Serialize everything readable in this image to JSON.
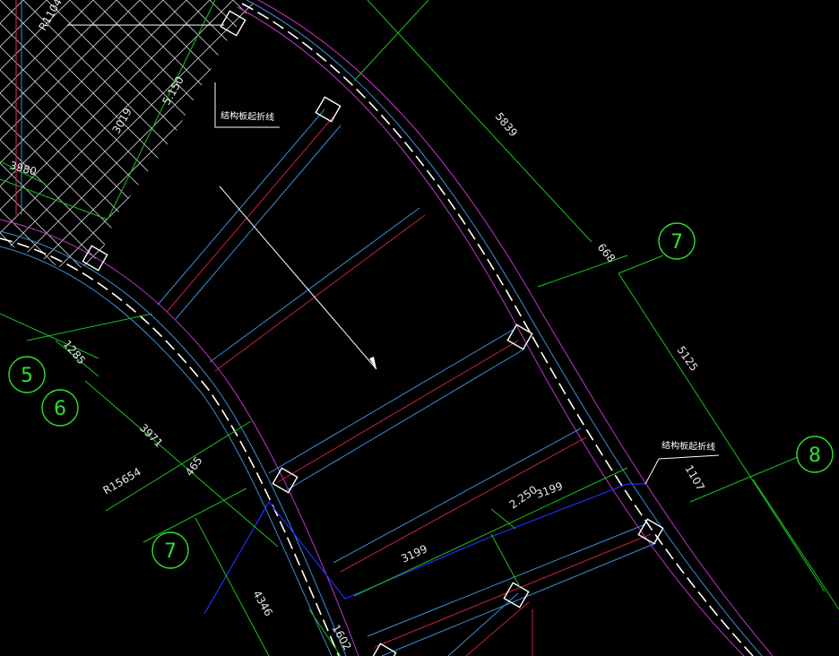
{
  "drawing": {
    "colors": {
      "background": "#000000",
      "axis_bubble": "#2fe02f",
      "dimension": "#19c419",
      "beam_edge": "#3a8fd6",
      "beam_center": "#c81e4b",
      "slab_edge": "#c035c8",
      "text": "#e8e8e8",
      "blue_line": "#1f2fff",
      "hatch": "#cfcfcf"
    },
    "grid_axes": [
      {
        "label": "5"
      },
      {
        "label": "6"
      },
      {
        "label": "7"
      },
      {
        "label": "7"
      },
      {
        "label": "8"
      }
    ],
    "dimensions": {
      "r1104": "R1104",
      "d5839": "5839",
      "d668": "668",
      "d5125": "5125",
      "d1107": "1107",
      "d3980": "3980",
      "d3019": "3019",
      "d5150": "5.150",
      "d1285": "1285",
      "d3971": "3971",
      "r15654": "R15654",
      "d465": "465",
      "d2250": "2.250",
      "d3199a": "3199",
      "d3199b": "3199",
      "d4346": "4346",
      "d1602": "1602"
    },
    "notes": {
      "fold_line_top": "结构板起折线",
      "fold_line_right": "结构板起折线"
    }
  }
}
